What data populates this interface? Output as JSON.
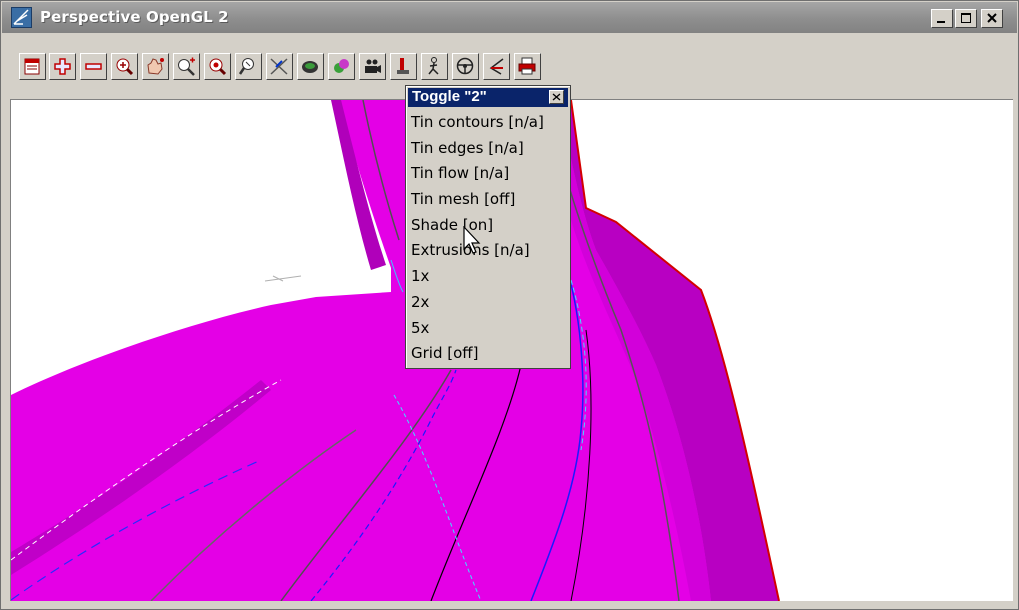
{
  "window": {
    "title": "Perspective OpenGL 2",
    "controls": {
      "minimize": "minimize-icon",
      "maximize": "maximize-icon",
      "close": "close-icon"
    }
  },
  "toolbar": {
    "buttons": [
      {
        "name": "toggle-panel-button",
        "icon": "panel-icon"
      },
      {
        "name": "add-button",
        "icon": "plus-icon"
      },
      {
        "name": "remove-button",
        "icon": "minus-icon"
      },
      {
        "name": "zoom-extent-button",
        "icon": "zoom-extent-icon"
      },
      {
        "name": "pan-button",
        "icon": "hand-icon"
      },
      {
        "name": "zoom-in-button",
        "icon": "zoom-in-icon"
      },
      {
        "name": "zoom-center-button",
        "icon": "zoom-center-icon"
      },
      {
        "name": "zoom-out-button",
        "icon": "zoom-out-icon"
      },
      {
        "name": "section-button",
        "icon": "section-icon"
      },
      {
        "name": "orbit-button",
        "icon": "orbit-icon"
      },
      {
        "name": "colour-button",
        "icon": "colour-icon"
      },
      {
        "name": "camera-button",
        "icon": "camera-icon"
      },
      {
        "name": "toggle-button",
        "icon": "toggle-icon"
      },
      {
        "name": "walk-button",
        "icon": "walk-icon"
      },
      {
        "name": "drive-button",
        "icon": "steering-wheel-icon"
      },
      {
        "name": "direction-button",
        "icon": "direction-icon"
      },
      {
        "name": "print-button",
        "icon": "printer-icon"
      }
    ]
  },
  "popup": {
    "title": "Toggle \"2\"",
    "close_icon": "close-icon",
    "items": [
      "Tin contours [n/a]",
      "Tin edges [n/a]",
      "Tin flow [n/a]",
      "Tin mesh [off]",
      "Shade [on]",
      "Extrusions [n/a]",
      "1x",
      "2x",
      "5x",
      "Grid [off]"
    ]
  },
  "scene": {
    "surface_color": "#e400e6",
    "surface_dark_color": "#b800c2",
    "edge_color": "#d40000"
  }
}
